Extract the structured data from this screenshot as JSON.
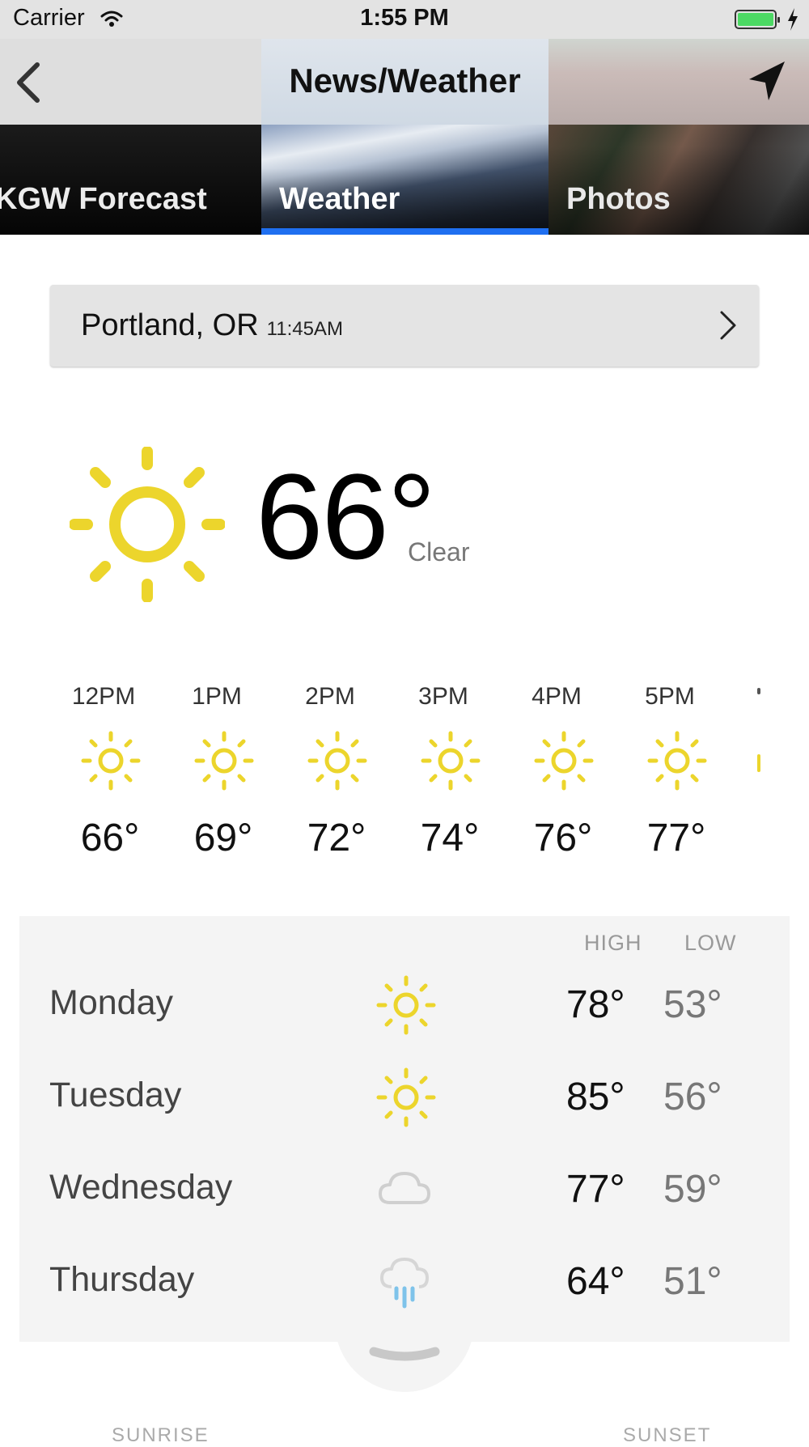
{
  "status_bar": {
    "carrier": "Carrier",
    "time": "1:55 PM"
  },
  "nav": {
    "title": "News/Weather"
  },
  "tabs": [
    {
      "label": "KGW Forecast"
    },
    {
      "label": "Weather"
    },
    {
      "label": "Photos"
    }
  ],
  "location": {
    "name": "Portland, OR",
    "time": "11:45AM"
  },
  "current": {
    "temp": "66°",
    "condition": "Clear",
    "icon": "sun-icon"
  },
  "hourly": [
    {
      "time": "12PM",
      "temp": "66°",
      "icon": "sun-icon"
    },
    {
      "time": "1PM",
      "temp": "69°",
      "icon": "sun-icon"
    },
    {
      "time": "2PM",
      "temp": "72°",
      "icon": "sun-icon"
    },
    {
      "time": "3PM",
      "temp": "74°",
      "icon": "sun-icon"
    },
    {
      "time": "4PM",
      "temp": "76°",
      "icon": "sun-icon"
    },
    {
      "time": "5PM",
      "temp": "77°",
      "icon": "sun-icon"
    }
  ],
  "daily": {
    "header_high": "HIGH",
    "header_low": "LOW",
    "days": [
      {
        "day": "Monday",
        "icon": "sun-icon",
        "high": "78°",
        "low": "53°"
      },
      {
        "day": "Tuesday",
        "icon": "sun-icon",
        "high": "85°",
        "low": "56°"
      },
      {
        "day": "Wednesday",
        "icon": "cloud-icon",
        "high": "77°",
        "low": "59°"
      },
      {
        "day": "Thursday",
        "icon": "rain-icon",
        "high": "64°",
        "low": "51°"
      }
    ]
  },
  "footer": {
    "sunrise": "SUNRISE",
    "sunset": "SUNSET"
  },
  "colors": {
    "accent": "#1f6ff0",
    "sun": "#ecd52c",
    "rain": "#7ec3ea",
    "battery": "#4cd964"
  }
}
